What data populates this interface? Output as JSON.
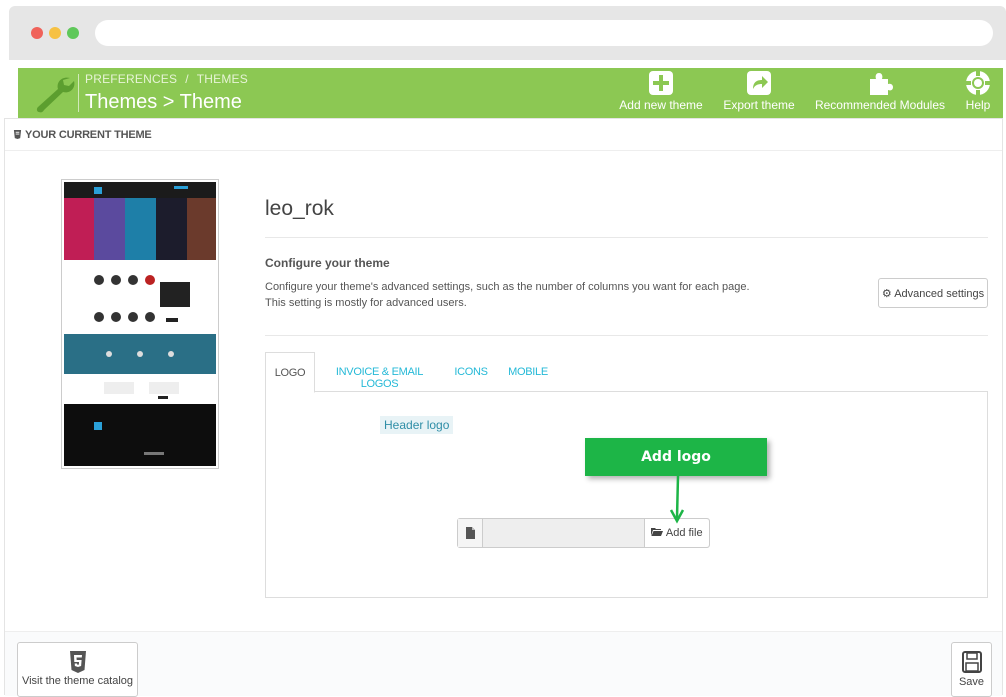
{
  "header": {
    "breadcrumb": [
      "PREFERENCES",
      "THEMES"
    ],
    "breadcrumb_sep": "/",
    "title": "Themes > Theme",
    "toolbar": [
      {
        "label": "Add new theme",
        "icon": "plus-square-icon"
      },
      {
        "label": "Export theme",
        "icon": "share-icon"
      },
      {
        "label": "Recommended Modules",
        "icon": "puzzle-icon"
      },
      {
        "label": "Help",
        "icon": "lifebuoy-icon"
      }
    ]
  },
  "panel": {
    "heading": "YOUR CURRENT THEME",
    "theme_name": "leo_rok",
    "configure_title": "Configure your theme",
    "configure_desc_line1": "Configure your theme's advanced settings, such as the number of columns you want for each page.",
    "configure_desc_line2": "This setting is mostly for advanced users.",
    "advanced_button": "Advanced settings",
    "tabs": [
      "LOGO",
      "INVOICE & EMAIL LOGOS",
      "ICONS",
      "MOBILE"
    ],
    "active_tab": "LOGO",
    "header_logo_label": "Header logo",
    "add_file_button": "Add file"
  },
  "callout": {
    "text": "Add logo",
    "color": "#1db547"
  },
  "footer": {
    "catalog_button": "Visit the theme catalog",
    "save_button": "Save"
  },
  "colors": {
    "header_green": "#8cc853",
    "link_blue": "#25b9d7"
  }
}
